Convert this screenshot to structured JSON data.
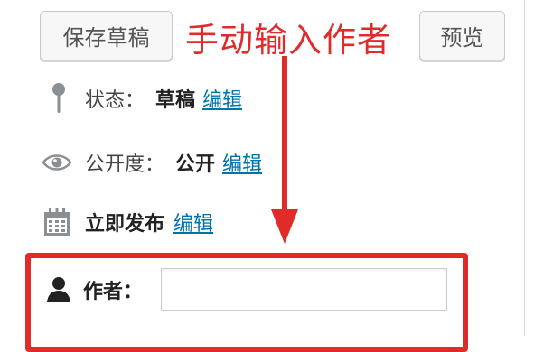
{
  "toolbar": {
    "save_draft_label": "保存草稿",
    "preview_label": "预览"
  },
  "annotation": {
    "text": "手动输入作者",
    "color": "#e02b2b"
  },
  "status": {
    "label": "状态：",
    "value": "草稿",
    "edit_label": "编辑",
    "icon": "pin-icon"
  },
  "visibility": {
    "label": "公开度：",
    "value": "公开",
    "edit_label": "编辑",
    "icon": "eye-icon"
  },
  "publish": {
    "label": "立即发布",
    "edit_label": "编辑",
    "icon": "calendar-icon"
  },
  "author": {
    "label": "作者：",
    "value": "",
    "placeholder": "",
    "icon": "user-icon"
  },
  "colors": {
    "link": "#0073aa",
    "highlight": "#e02b2b"
  }
}
